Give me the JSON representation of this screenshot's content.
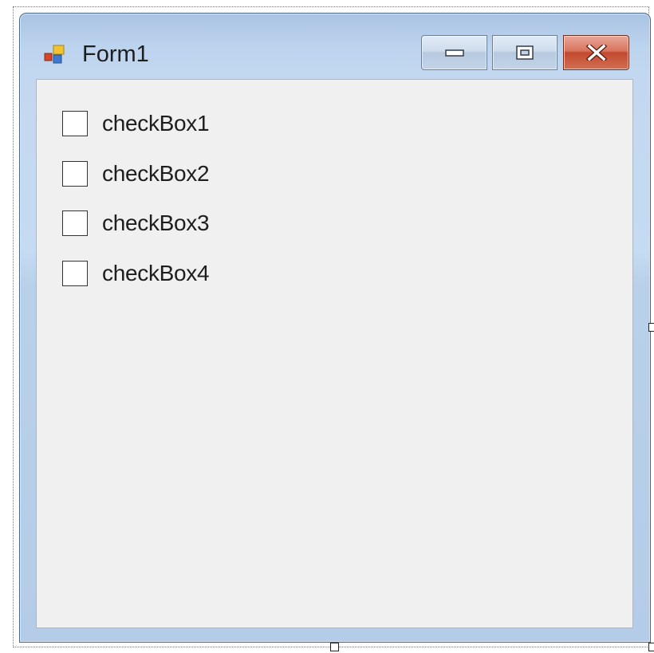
{
  "window": {
    "title": "Form1",
    "icon": "winforms-app-icon"
  },
  "caption_buttons": [
    {
      "name": "minimize",
      "icon": "minimize-icon"
    },
    {
      "name": "maximize",
      "icon": "maximize-icon"
    },
    {
      "name": "close",
      "icon": "close-icon"
    }
  ],
  "checkboxes": [
    {
      "label": "checkBox1",
      "checked": false
    },
    {
      "label": "checkBox2",
      "checked": false
    },
    {
      "label": "checkBox3",
      "checked": false
    },
    {
      "label": "checkBox4",
      "checked": false
    }
  ],
  "colors": {
    "frame": "#bcd3ee",
    "client": "#f0f0f0",
    "close_button": "#c24a30"
  }
}
